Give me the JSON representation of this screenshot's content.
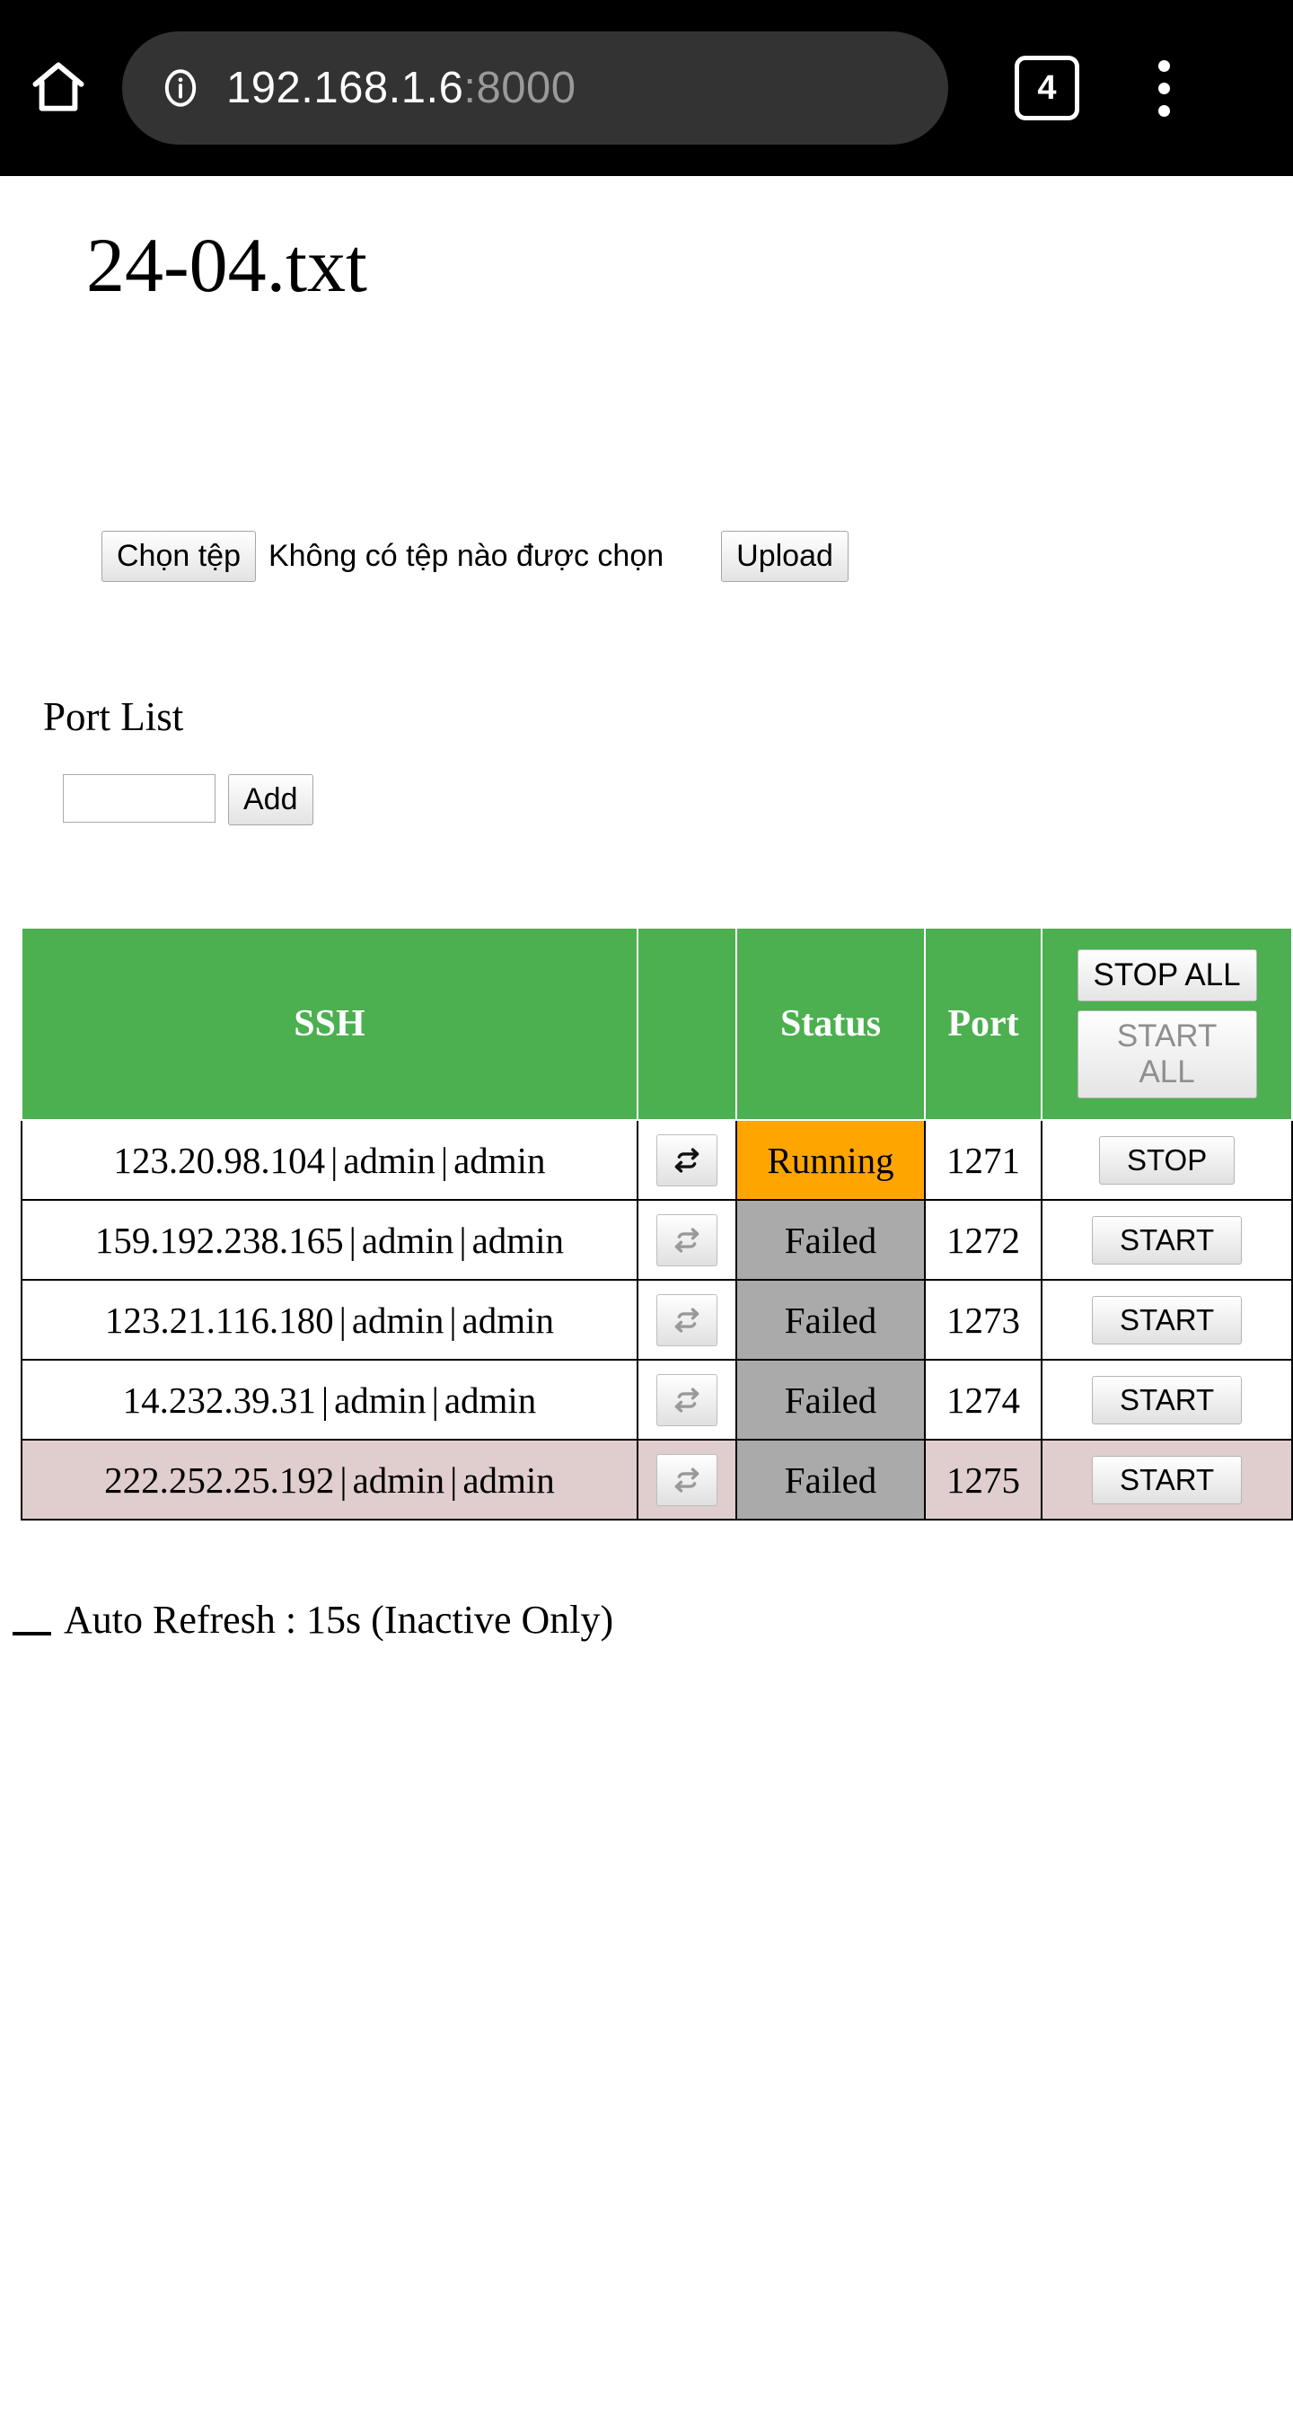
{
  "browser": {
    "home_icon": "home-icon",
    "info_icon": "info-icon",
    "url_host": "192.168.1.6",
    "url_port": ":8000",
    "tab_count": "4",
    "menu_icon": "overflow-menu-icon"
  },
  "page": {
    "title": "24-04.txt",
    "upload": {
      "choose_file_label": "Chọn tệp",
      "no_file_label": "Không có tệp nào được chọn",
      "upload_label": "Upload"
    },
    "port_list": {
      "heading": "Port List",
      "input_value": "",
      "input_placeholder": "",
      "add_label": "Add"
    },
    "table": {
      "headers": {
        "ssh": "SSH",
        "refresh": "",
        "status": "Status",
        "port": "Port",
        "stop_all": "STOP ALL",
        "start_all": "START ALL"
      },
      "rows": [
        {
          "host": "123.20.98.104",
          "user": "admin",
          "password": "admin",
          "sep": "|",
          "refresh_icon": "refresh-icon",
          "refresh_state": "active",
          "status": "Running",
          "status_kind": "running",
          "port": "1271",
          "action": "STOP",
          "highlight": false
        },
        {
          "host": "159.192.238.165",
          "user": "admin",
          "password": "admin",
          "sep": "|",
          "refresh_icon": "refresh-icon",
          "refresh_state": "inactive",
          "status": "Failed",
          "status_kind": "failed",
          "port": "1272",
          "action": "START",
          "highlight": false
        },
        {
          "host": "123.21.116.180",
          "user": "admin",
          "password": "admin",
          "sep": "|",
          "refresh_icon": "refresh-icon",
          "refresh_state": "inactive",
          "status": "Failed",
          "status_kind": "failed",
          "port": "1273",
          "action": "START",
          "highlight": false
        },
        {
          "host": "14.232.39.31",
          "user": "admin",
          "password": "admin",
          "sep": "|",
          "refresh_icon": "refresh-icon",
          "refresh_state": "inactive",
          "status": "Failed",
          "status_kind": "failed",
          "port": "1274",
          "action": "START",
          "highlight": false
        },
        {
          "host": "222.252.25.192",
          "user": "admin",
          "password": "admin",
          "sep": "|",
          "refresh_icon": "refresh-icon",
          "refresh_state": "inactive",
          "status": "Failed",
          "status_kind": "failed",
          "port": "1275",
          "action": "START",
          "highlight": true
        }
      ]
    },
    "auto_refresh": {
      "checked": false,
      "label": "Auto Refresh : 15s (Inactive Only)"
    }
  },
  "colors": {
    "header_green": "#4caf50",
    "status_running": "#ffa500",
    "status_failed": "#aaaaaa",
    "row_highlight": "#e0cdcd",
    "chrome_black": "#000000",
    "url_pill": "#333333"
  }
}
